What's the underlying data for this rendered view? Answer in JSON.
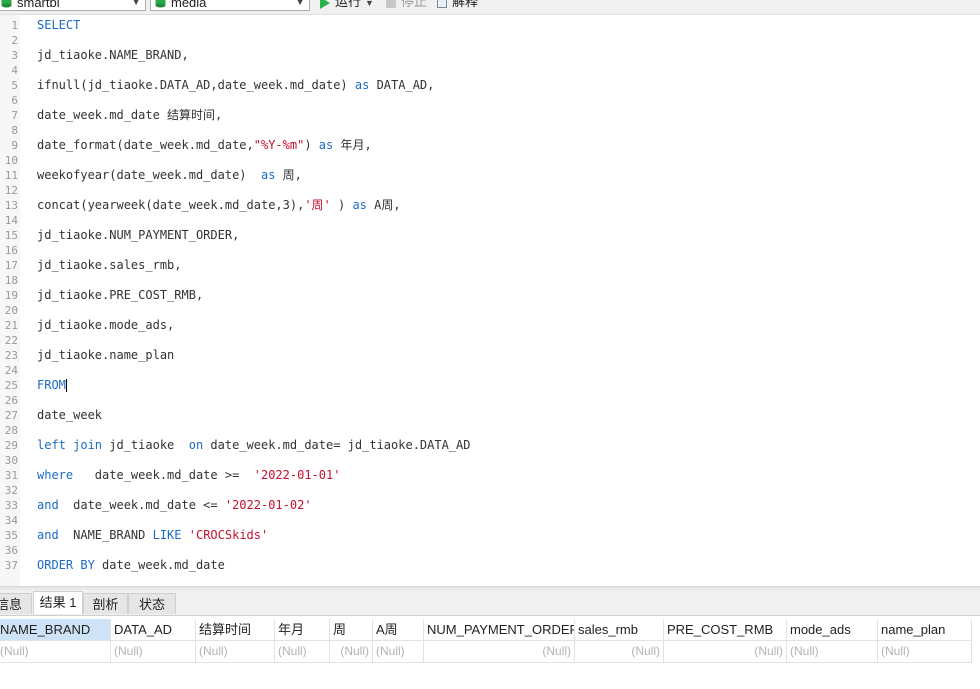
{
  "toolbar": {
    "connection": "smartbi",
    "database": "media",
    "run_label": "运行",
    "stop_label": "停止",
    "explain_label": "解释"
  },
  "editor": {
    "lines": [
      {
        "n": "1",
        "parts": [
          {
            "t": "SELECT",
            "c": "kw"
          }
        ]
      },
      {
        "n": "2",
        "parts": []
      },
      {
        "n": "3",
        "parts": [
          {
            "t": "jd_tiaoke.NAME_BRAND,",
            "c": ""
          }
        ]
      },
      {
        "n": "4",
        "parts": []
      },
      {
        "n": "5",
        "parts": [
          {
            "t": "ifnull(jd_tiaoke.DATA_AD,date_week.md_date) ",
            "c": ""
          },
          {
            "t": "as",
            "c": "kw"
          },
          {
            "t": " DATA_AD,",
            "c": ""
          }
        ]
      },
      {
        "n": "6",
        "parts": []
      },
      {
        "n": "7",
        "parts": [
          {
            "t": "date_week.md_date 结算时间,",
            "c": ""
          }
        ]
      },
      {
        "n": "8",
        "parts": []
      },
      {
        "n": "9",
        "parts": [
          {
            "t": "date_format(date_week.md_date,",
            "c": ""
          },
          {
            "t": "\"%Y-%m\"",
            "c": "str"
          },
          {
            "t": ") ",
            "c": ""
          },
          {
            "t": "as",
            "c": "kw"
          },
          {
            "t": " 年月,",
            "c": ""
          }
        ]
      },
      {
        "n": "10",
        "parts": []
      },
      {
        "n": "11",
        "parts": [
          {
            "t": "weekofyear(date_week.md_date)  ",
            "c": ""
          },
          {
            "t": "as",
            "c": "kw"
          },
          {
            "t": " 周,",
            "c": ""
          }
        ]
      },
      {
        "n": "12",
        "parts": []
      },
      {
        "n": "13",
        "parts": [
          {
            "t": "concat(yearweek(date_week.md_date,3),",
            "c": ""
          },
          {
            "t": "'周'",
            "c": "str"
          },
          {
            "t": " ) ",
            "c": ""
          },
          {
            "t": "as",
            "c": "kw"
          },
          {
            "t": " A周,",
            "c": ""
          }
        ]
      },
      {
        "n": "14",
        "parts": []
      },
      {
        "n": "15",
        "parts": [
          {
            "t": "jd_tiaoke.NUM_PAYMENT_ORDER,",
            "c": ""
          }
        ]
      },
      {
        "n": "16",
        "parts": []
      },
      {
        "n": "17",
        "parts": [
          {
            "t": "jd_tiaoke.sales_rmb,",
            "c": ""
          }
        ]
      },
      {
        "n": "18",
        "parts": []
      },
      {
        "n": "19",
        "parts": [
          {
            "t": "jd_tiaoke.PRE_COST_RMB,",
            "c": ""
          }
        ]
      },
      {
        "n": "20",
        "parts": []
      },
      {
        "n": "21",
        "parts": [
          {
            "t": "jd_tiaoke.mode_ads,",
            "c": ""
          }
        ]
      },
      {
        "n": "22",
        "parts": []
      },
      {
        "n": "23",
        "parts": [
          {
            "t": "jd_tiaoke.name_plan",
            "c": ""
          }
        ]
      },
      {
        "n": "24",
        "parts": []
      },
      {
        "n": "25",
        "parts": [
          {
            "t": "FROM",
            "c": "kw"
          }
        ],
        "cursor": true
      },
      {
        "n": "26",
        "parts": []
      },
      {
        "n": "27",
        "parts": [
          {
            "t": "date_week",
            "c": ""
          }
        ]
      },
      {
        "n": "28",
        "parts": []
      },
      {
        "n": "29",
        "parts": [
          {
            "t": "left join",
            "c": "kw"
          },
          {
            "t": " jd_tiaoke  ",
            "c": ""
          },
          {
            "t": "on",
            "c": "kw"
          },
          {
            "t": " date_week.md_date= jd_tiaoke.DATA_AD",
            "c": ""
          }
        ]
      },
      {
        "n": "30",
        "parts": []
      },
      {
        "n": "31",
        "parts": [
          {
            "t": "where",
            "c": "kw"
          },
          {
            "t": "   date_week.md_date >=  ",
            "c": ""
          },
          {
            "t": "'2022-01-01'",
            "c": "str"
          }
        ]
      },
      {
        "n": "32",
        "parts": []
      },
      {
        "n": "33",
        "parts": [
          {
            "t": "and",
            "c": "kw"
          },
          {
            "t": "  date_week.md_date <= ",
            "c": ""
          },
          {
            "t": "'2022-01-02'",
            "c": "str"
          }
        ]
      },
      {
        "n": "34",
        "parts": []
      },
      {
        "n": "35",
        "parts": [
          {
            "t": "and",
            "c": "kw"
          },
          {
            "t": "  NAME_BRAND ",
            "c": ""
          },
          {
            "t": "LIKE",
            "c": "kw"
          },
          {
            "t": " ",
            "c": ""
          },
          {
            "t": "'CROCSkids'",
            "c": "str"
          }
        ]
      },
      {
        "n": "36",
        "parts": []
      },
      {
        "n": "37",
        "parts": [
          {
            "t": "ORDER BY",
            "c": "kw"
          },
          {
            "t": " date_week.md_date",
            "c": ""
          }
        ]
      }
    ]
  },
  "tabs": [
    {
      "key": "info",
      "label": "信息",
      "active": false
    },
    {
      "key": "result",
      "label": "结果 1",
      "active": true
    },
    {
      "key": "profile",
      "label": "剖析",
      "active": false
    },
    {
      "key": "status",
      "label": "状态",
      "active": false
    }
  ],
  "grid": {
    "columns": [
      "NAME_BRAND",
      "DATA_AD",
      "结算时间",
      "年月",
      "周",
      "A周",
      "NUM_PAYMENT_ORDER",
      "sales_rmb",
      "PRE_COST_RMB",
      "mode_ads",
      "name_plan"
    ],
    "rows": [
      [
        "(Null)",
        "(Null)",
        "(Null)",
        "(Null)",
        "(Null)",
        "(Null)",
        "(Null)",
        "(Null)",
        "(Null)",
        "(Null)",
        "(Null)"
      ]
    ],
    "numeric_columns": [
      4,
      6,
      7,
      8
    ]
  }
}
